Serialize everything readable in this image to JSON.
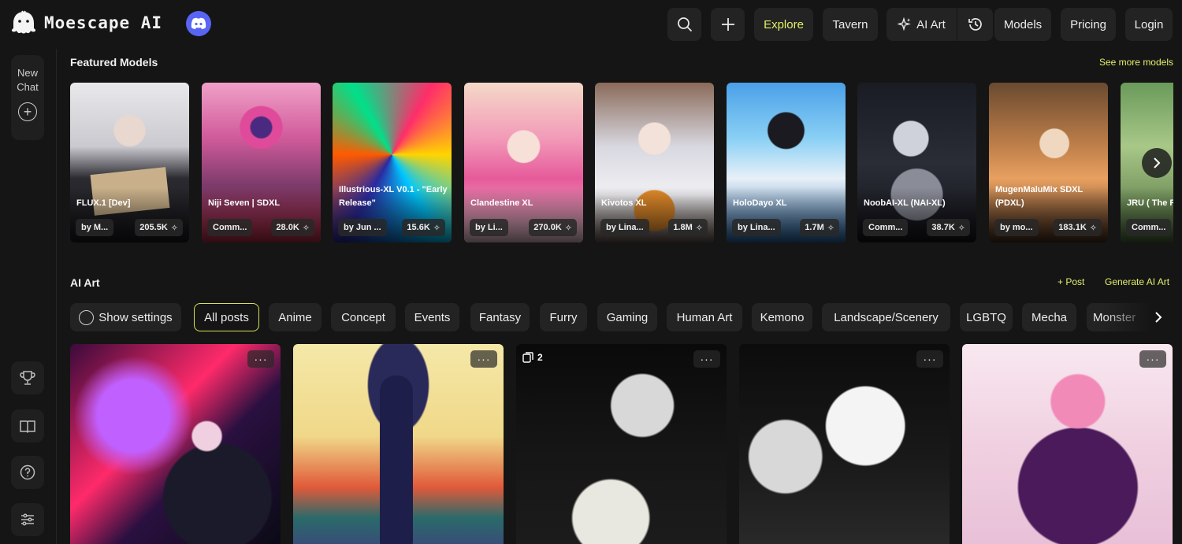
{
  "header": {
    "logo_text": "Moescape AI",
    "nav": {
      "explore": "Explore",
      "tavern": "Tavern",
      "ai_art": "AI Art",
      "models": "Models",
      "pricing": "Pricing",
      "login": "Login"
    }
  },
  "sidebar": {
    "new_chat_line1": "New",
    "new_chat_line2": "Chat"
  },
  "featured": {
    "title": "Featured Models",
    "see_more": "See more models",
    "cards": [
      {
        "name": "FLUX.1 [Dev]",
        "by": "by M...",
        "count": "205.5K"
      },
      {
        "name": "Niji Seven | SDXL",
        "by": "Comm...",
        "count": "28.0K"
      },
      {
        "name": "Illustrious-XL V0.1 - \"Early Release\"",
        "by": "by Jun ...",
        "count": "15.6K"
      },
      {
        "name": "Clandestine XL",
        "by": "by Li...",
        "count": "270.0K"
      },
      {
        "name": "Kivotos XL",
        "by": "by Lina...",
        "count": "1.8M"
      },
      {
        "name": "HoloDayo XL",
        "by": "by Lina...",
        "count": "1.7M"
      },
      {
        "name": "NoobAI-XL (NAI-XL)",
        "by": "Comm...",
        "count": "38.7K"
      },
      {
        "name": "MugenMaluMix SDXL (PDXL)",
        "by": "by mo...",
        "count": "183.1K"
      },
      {
        "name": "JRU ( The Remains U",
        "by": "Comm...",
        "count": ""
      }
    ]
  },
  "ai_art": {
    "title": "AI Art",
    "post": "Post",
    "generate": "Generate AI Art",
    "show_settings": "Show settings",
    "chips": [
      "All posts",
      "Anime",
      "Concept",
      "Events",
      "Fantasy",
      "Furry",
      "Gaming",
      "Human Art",
      "Kemono",
      "Landscape/Scenery",
      "LGBTQ",
      "Mecha",
      "Monster"
    ],
    "multi_count": "2"
  }
}
